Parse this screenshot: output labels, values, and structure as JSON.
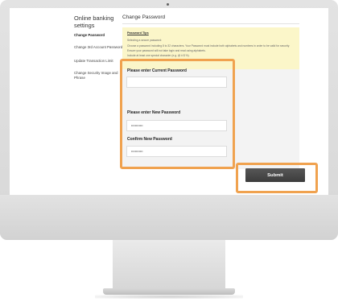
{
  "sidebar": {
    "heading": "Online banking settings",
    "items": [
      {
        "label": "Change Password",
        "active": true
      },
      {
        "label": "Change 3rd Account Password",
        "active": false
      },
      {
        "label": "Update Transaction Limit",
        "active": false
      },
      {
        "label": "Change Security Image and Phrase",
        "active": false
      }
    ]
  },
  "main": {
    "title": "Change Password",
    "tips": {
      "title": "Password Tips",
      "intro": "Selecting a secure password:",
      "lines": [
        "Choose a password including 8 to 32 characters. Your Password must include both alphabets and numbers in order to be valid for security.",
        "Ensure your password will not take login and read using alphabets.",
        "Include at least one special character (e.g. @ # $ %)."
      ]
    },
    "fields": [
      {
        "label": "Please enter Current Password",
        "value": ""
      },
      {
        "label": "Please enter New Password",
        "value": "••••••••••••"
      },
      {
        "label": "Confirm New Password",
        "value": "••••••••••••"
      }
    ],
    "submit_label": "Submit"
  },
  "colors": {
    "highlight": "#f0a24f",
    "tips_background": "#fbf6c9",
    "submit_background": "#474747"
  }
}
